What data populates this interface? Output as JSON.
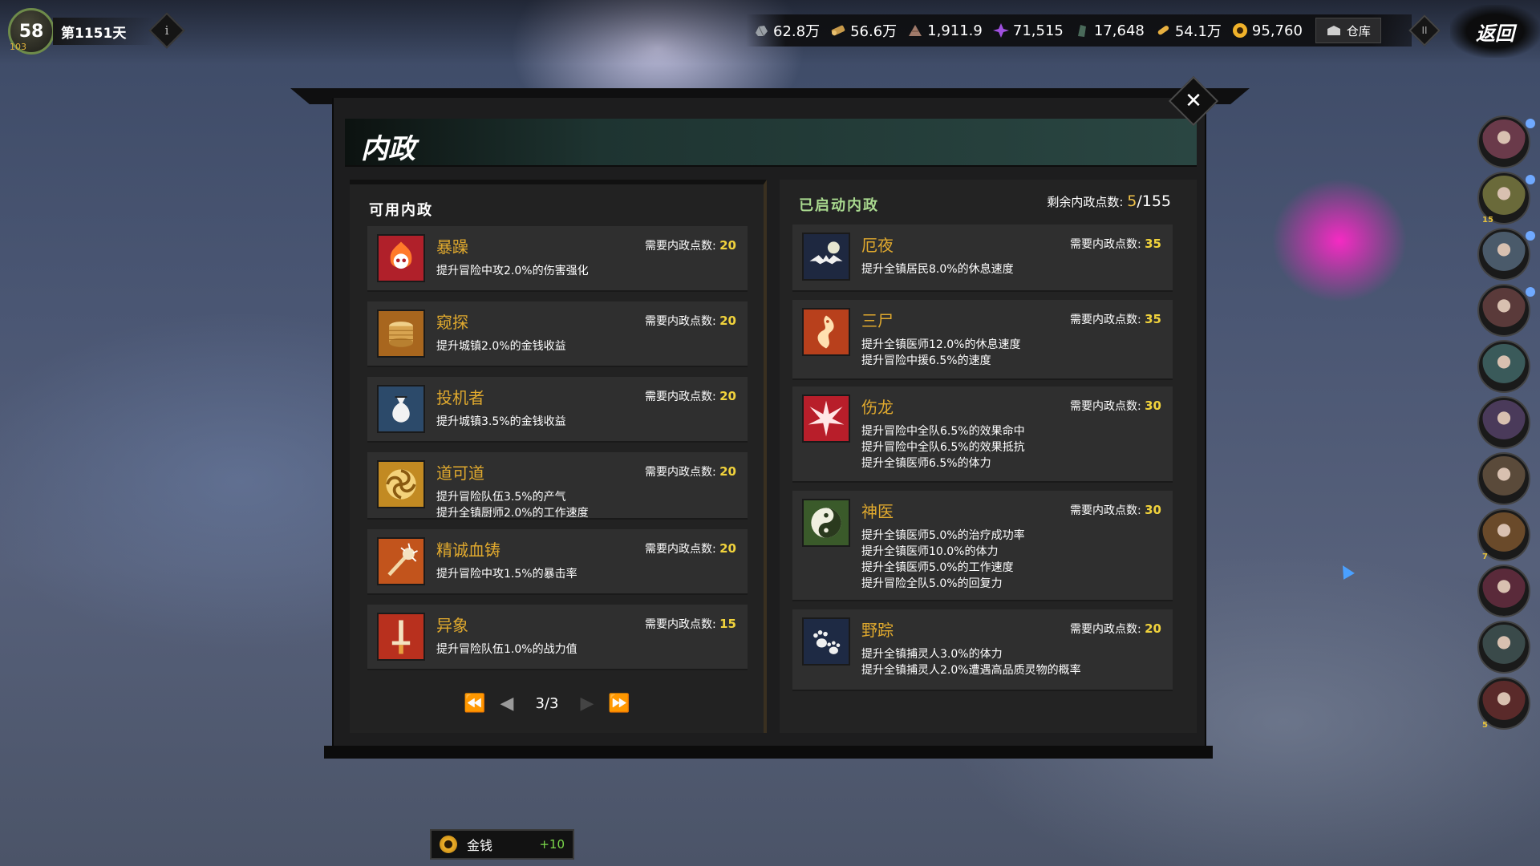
{
  "hud": {
    "level": "58",
    "level_sub": "103",
    "day": "第1151天",
    "info_label": "i",
    "pause_label": "II",
    "return_label": "返回"
  },
  "resources": [
    {
      "icon": "stone-icon",
      "value": "62.8万"
    },
    {
      "icon": "wood-icon",
      "value": "56.6万"
    },
    {
      "icon": "ore-icon",
      "value": "1,911.9"
    },
    {
      "icon": "soul-crystal-icon",
      "value": "71,515"
    },
    {
      "icon": "jade-icon",
      "value": "17,648"
    },
    {
      "icon": "scroll-icon",
      "value": "54.1万"
    },
    {
      "icon": "gold-coin-icon",
      "value": "95,760"
    }
  ],
  "storage_label": "仓库",
  "dialog": {
    "title": "内政",
    "close_label": "✕"
  },
  "available": {
    "heading": "可用内政",
    "cost_label": "需要内政点数:",
    "items": [
      {
        "name": "暴躁",
        "cost": "20",
        "icon": "flaming-skull-icon",
        "desc": [
          "提升冒险中攻2.0%的伤害强化"
        ]
      },
      {
        "name": "窥探",
        "cost": "20",
        "icon": "coin-stack-icon",
        "desc": [
          "提升城镇2.0%的金钱收益"
        ]
      },
      {
        "name": "投机者",
        "cost": "20",
        "icon": "money-bag-icon",
        "desc": [
          "提升城镇3.5%的金钱收益"
        ]
      },
      {
        "name": "道可道",
        "cost": "20",
        "icon": "swirl-icon",
        "desc": [
          "提升冒险队伍3.5%的产气",
          "提升全镇厨师2.0%的工作速度"
        ]
      },
      {
        "name": "精诚血铸",
        "cost": "20",
        "icon": "spiked-mace-icon",
        "desc": [
          "提升冒险中攻1.5%的暴击率"
        ]
      },
      {
        "name": "异象",
        "cost": "15",
        "icon": "sword-icon",
        "desc": [
          "提升冒险队伍1.0%的战力值"
        ]
      }
    ],
    "pager": {
      "current": "3/3"
    }
  },
  "active": {
    "heading": "已启动内政",
    "remaining_label": "剩余内政点数:",
    "remaining_used": "5",
    "remaining_total": "/155",
    "cost_label": "需要内政点数:",
    "items": [
      {
        "name": "厄夜",
        "cost": "35",
        "icon": "bat-icon",
        "desc": [
          "提升全镇居民8.0%的休息速度"
        ]
      },
      {
        "name": "三尸",
        "cost": "35",
        "icon": "serpent-flame-icon",
        "desc": [
          "提升全镇医师12.0%的休息速度",
          "提升冒险中援6.5%的速度"
        ]
      },
      {
        "name": "伤龙",
        "cost": "30",
        "icon": "burst-star-icon",
        "desc": [
          "提升冒险中全队6.5%的效果命中",
          "提升冒险中全队6.5%的效果抵抗",
          "提升全镇医师6.5%的体力"
        ]
      },
      {
        "name": "神医",
        "cost": "30",
        "icon": "yin-yang-icon",
        "desc": [
          "提升全镇医师5.0%的治疗成功率",
          "提升全镇医师10.0%的体力",
          "提升全镇医师5.0%的工作速度",
          "提升冒险全队5.0%的回复力"
        ]
      },
      {
        "name": "野踪",
        "cost": "20",
        "icon": "paw-print-icon",
        "desc": [
          "提升全镇捕灵人3.0%的体力",
          "提升全镇捕灵人2.0%遭遇高品质灵物的概率"
        ]
      }
    ]
  },
  "reward": {
    "label": "金钱",
    "amount": "+10"
  },
  "portraits": [
    {
      "badge": ""
    },
    {
      "badge": "15"
    },
    {
      "badge": ""
    },
    {
      "badge": ""
    },
    {
      "badge": ""
    },
    {
      "badge": ""
    },
    {
      "badge": ""
    },
    {
      "badge": "7"
    },
    {
      "badge": ""
    },
    {
      "badge": ""
    },
    {
      "badge": "5"
    }
  ],
  "colors": {
    "accent_gold": "#e0a92e",
    "cost_yellow": "#f0d23c",
    "heading_green": "#a9d98f",
    "reward_green": "#7bd84a"
  }
}
